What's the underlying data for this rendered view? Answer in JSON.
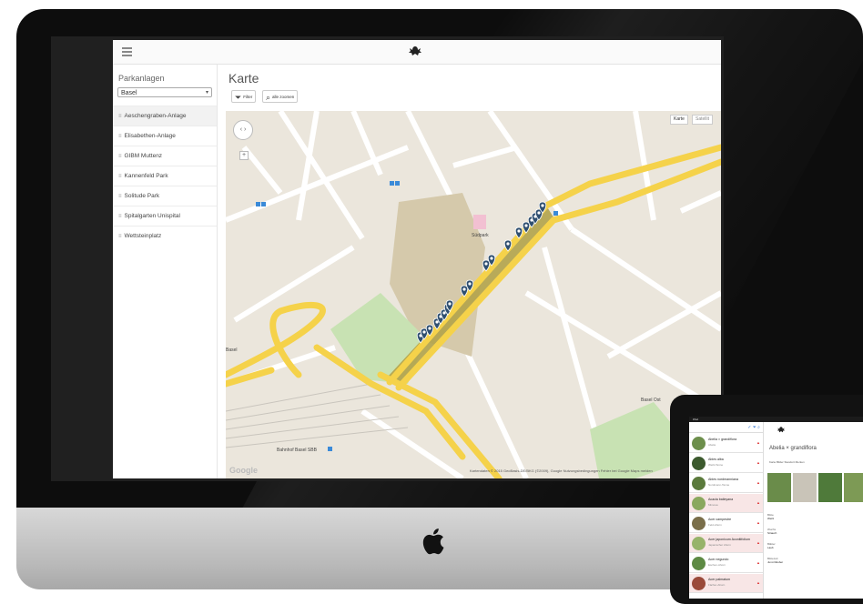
{
  "app": {
    "sidebar": {
      "title": "Parkanlagen",
      "select_value": "Basel",
      "items": [
        {
          "label": "Aeschengraben-Anlage"
        },
        {
          "label": "Elisabethen-Anlage"
        },
        {
          "label": "GIBM Muttenz"
        },
        {
          "label": "Kannenfeld Park"
        },
        {
          "label": "Solitude Park"
        },
        {
          "label": "Spitalgarten Unispital"
        },
        {
          "label": "Wettsteinplatz"
        }
      ]
    },
    "main": {
      "title": "Karte",
      "filter_label": "Filter",
      "zoom_all_label": "alle zoomen"
    },
    "map": {
      "type_map": "Karte",
      "type_satellite": "Satellit",
      "labels": {
        "sudpark": "Südpark",
        "basel": "Basel",
        "bahnhof": "Bahnhof Basel SBB",
        "basel_right": "Basel Ost"
      },
      "attribution": "Kartendaten © 2015 GeoBasis-DE/BKG (©2009), Google   Nutzungsbedingungen   Fehler bei Google Maps melden",
      "google": "Google"
    },
    "colors": {
      "road_yellow": "#f5d24a",
      "park_green": "#c8e2b3",
      "highlight": "#b3a34a",
      "marker": "#2f4f70"
    }
  },
  "tablet": {
    "status": "iPad",
    "list": [
      {
        "name": "Abelia × grandiflora",
        "sub": "Abelie"
      },
      {
        "name": "Abies alba",
        "sub": "Weiß-Tanne"
      },
      {
        "name": "Abies nordmanniana",
        "sub": "Nordmann-Tanne"
      },
      {
        "name": "Acacia baileyana",
        "sub": "Mimosa"
      },
      {
        "name": "Acer campestre",
        "sub": "Feld-Ahorn"
      },
      {
        "name": "Acer japonicum Aconitifolium",
        "sub": "Japanischer Ahorn"
      },
      {
        "name": "Acer negundo",
        "sub": "Eschen-Ahorn"
      },
      {
        "name": "Acer palmatum",
        "sub": "Fächer-Ahorn"
      }
    ],
    "detail": {
      "title": "Abelia × grandiflora",
      "tabs": "Karte   Bilder   Standort   Merken",
      "fields": [
        {
          "label": "Blüte",
          "value": "Weiß"
        },
        {
          "label": "Wuchs",
          "value": "Strauch"
        },
        {
          "label": "Blätter",
          "value": "Laub"
        },
        {
          "label": "Blütezeit",
          "value": "Juni-Oktober"
        }
      ]
    }
  }
}
